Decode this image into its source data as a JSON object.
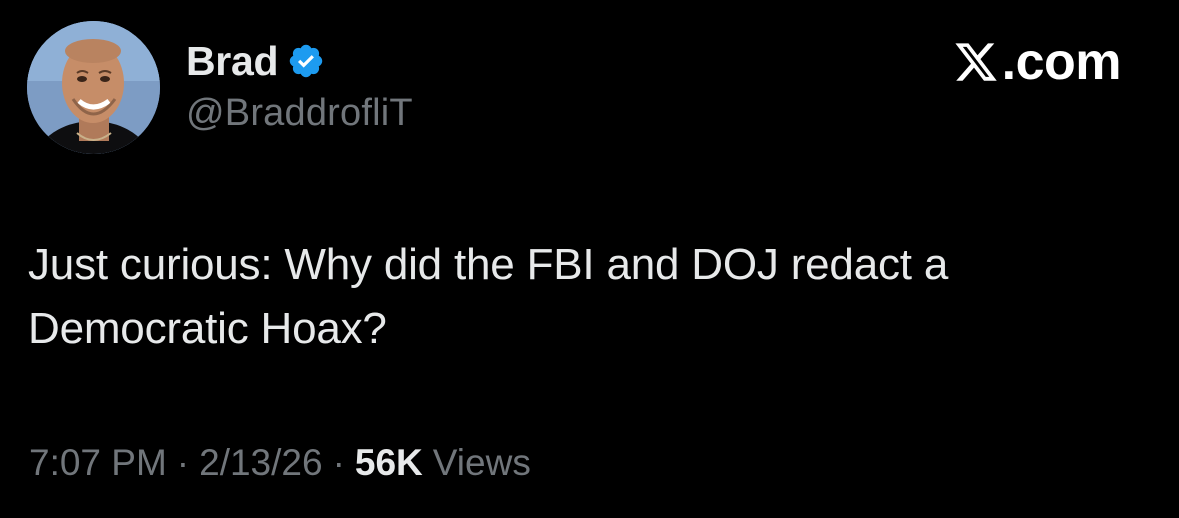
{
  "author": {
    "display_name": "Brad",
    "handle": "@BraddrofliT",
    "verified": true,
    "verified_color": "#1d9bf0",
    "avatar_icon": "profile-photo"
  },
  "brand": {
    "icon": "x-logo-icon",
    "text": ".com"
  },
  "tweet": {
    "text": "Just curious: Why did the FBI and DOJ redact a Democratic Hoax?"
  },
  "meta": {
    "time": "7:07 PM",
    "separator": "·",
    "date": "2/13/26",
    "views_count": "56K",
    "views_label": "Views"
  },
  "colors": {
    "background": "#000000",
    "primary_text": "#e7e9ea",
    "secondary_text": "#71767b"
  }
}
